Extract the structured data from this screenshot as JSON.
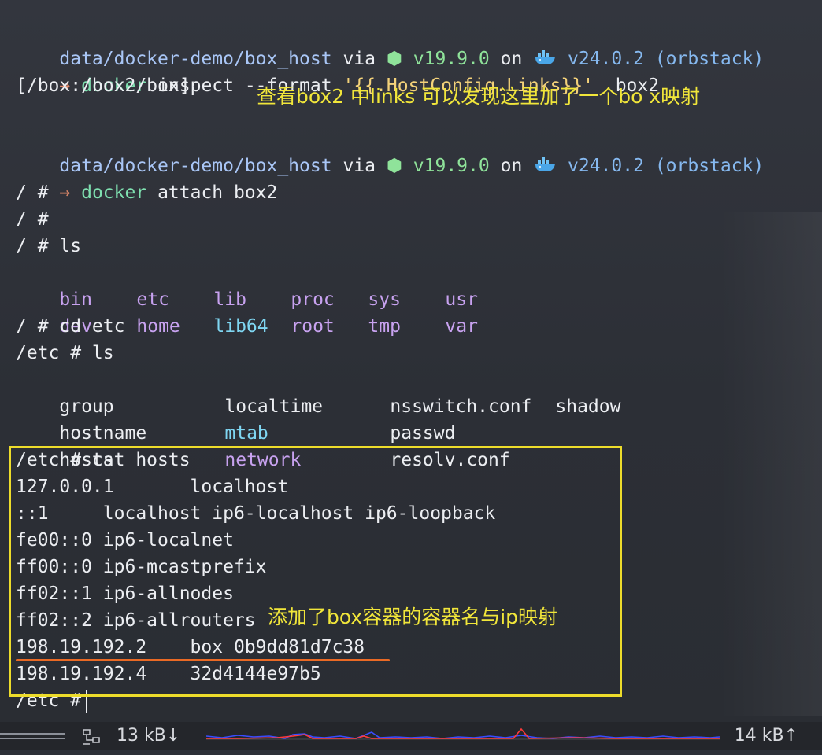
{
  "prompt": {
    "path": "data/docker-demo/box_host",
    "via": "via",
    "node_icon": "hexagon-icon",
    "node_version": "v19.9.0",
    "on": "on",
    "docker_icon": "whale-icon",
    "docker_version": "v24.0.2",
    "context": "(orbstack)",
    "arrow": "→"
  },
  "block1": {
    "cmd": "docker",
    "args": "inspect --format",
    "format_string": "'{{.HostConfig.Links}}'",
    "target": "box2",
    "output": "[/box:/box2/box]"
  },
  "annotations": {
    "links_note": "查看box2 中links 可以发现这里加了一个bo x映射",
    "hosts_note": "添加了box容器的容器名与ip映射"
  },
  "block2": {
    "cmd": "docker",
    "args": "attach box2",
    "shell_lines": [
      "/ #",
      "/ #"
    ],
    "ls_cmd": "/ # ls",
    "root_dirs_row1": [
      "bin",
      "etc",
      "lib",
      "proc",
      "sys",
      "usr"
    ],
    "root_dirs_row2": [
      "dev",
      "home",
      "lib64",
      "root",
      "tmp",
      "var"
    ],
    "cd_cmd": "/ # cd etc",
    "etc_ls_cmd": "/etc # ls",
    "etc_row1": [
      "group",
      "localtime",
      "nsswitch.conf",
      "shadow"
    ],
    "etc_row2": [
      "hostname",
      "mtab",
      "passwd"
    ],
    "etc_row3": [
      "hosts",
      "network",
      "resolv.conf"
    ],
    "cat_cmd": "/etc # cat hosts",
    "hosts": [
      "127.0.0.1       localhost",
      "::1     localhost ip6-localhost ip6-loopback",
      "fe00::0 ip6-localnet",
      "ff00::0 ip6-mcastprefix",
      "ff02::1 ip6-allnodes",
      "ff02::2 ip6-allrouters",
      "198.19.192.2    box 0b9dd81d7c38",
      "198.19.192.4    32d4144e97b5"
    ],
    "final_prompt": "/etc #"
  },
  "statusbar": {
    "network_icon": "network-icon",
    "download": "13 kB↓",
    "upload": "14 kB↑",
    "graph_colors": {
      "down": "#3a4cff",
      "up": "#ff3b3b"
    }
  },
  "colors": {
    "background": "#2e3138",
    "annotation": "#f1e63a",
    "highlight_border": "#eddc2b",
    "underline": "#ea6a25"
  }
}
